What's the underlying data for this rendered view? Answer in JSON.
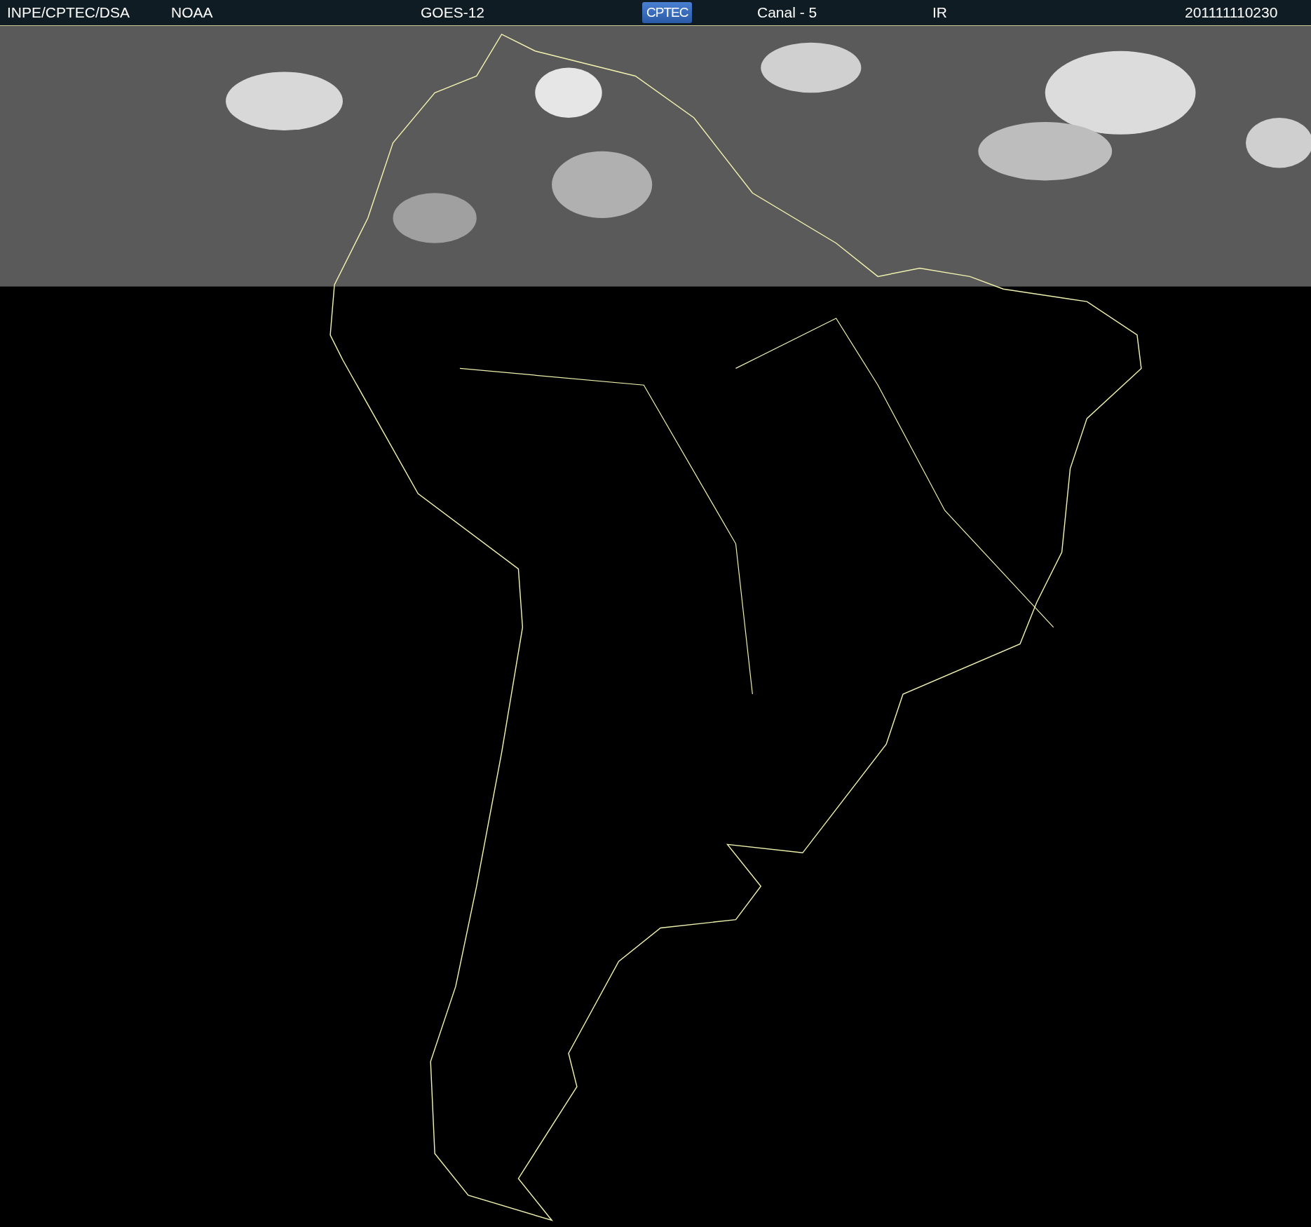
{
  "header": [
    {
      "kind": "text",
      "text": "INPE/CPTEC/DSA"
    },
    {
      "kind": "text",
      "text": "NOAA"
    },
    {
      "kind": "text",
      "text": "GOES-12"
    },
    {
      "kind": "logo",
      "text": "CPTEC"
    },
    {
      "kind": "text",
      "text": "Canal - 5"
    },
    {
      "kind": "text",
      "text": "IR"
    },
    {
      "kind": "text",
      "text": "201111110230"
    }
  ]
}
